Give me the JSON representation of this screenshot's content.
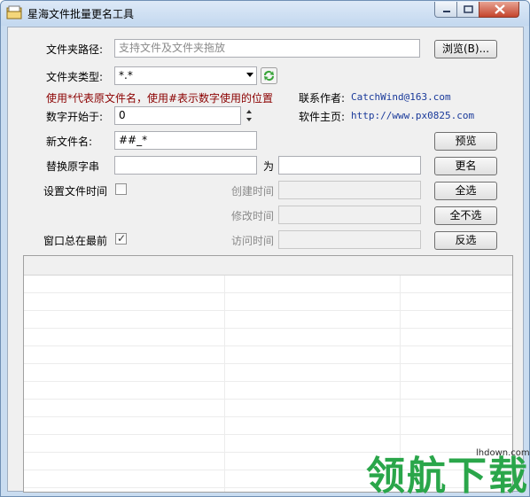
{
  "window": {
    "title": "星海文件批量更名工具",
    "controls": {
      "minimize": "minimize-icon",
      "maximize": "maximize-icon",
      "close": "close-icon"
    }
  },
  "folder_path": {
    "label": "文件夹路径:",
    "placeholder": "支持文件及文件夹拖放",
    "browse_label": "浏览(B)..."
  },
  "folder_type": {
    "label": "文件夹类型:",
    "value": "*.*",
    "refresh_icon": "refresh-icon"
  },
  "hint": "使用*代表原文件名，使用#表示数字使用的位置",
  "contact": {
    "label": "联系作者:",
    "value": "CatchWind@163.com"
  },
  "homepage": {
    "label": "软件主页:",
    "value": "http://www.px0825.com"
  },
  "start_number": {
    "label": "数字开始于:",
    "value": "0"
  },
  "new_name": {
    "label": "新文件名:",
    "value": "##_*"
  },
  "replace": {
    "label": "替换原字串",
    "for_label": "为",
    "find_value": "",
    "replace_value": ""
  },
  "set_time": {
    "label": "设置文件时间",
    "checked": false
  },
  "time_fields": {
    "created": "创建时间",
    "modified": "修改时间",
    "accessed": "访问时间"
  },
  "always_on_top": {
    "label": "窗口总在最前",
    "checked": true
  },
  "buttons": {
    "preview": "预览",
    "rename": "更名",
    "select_all": "全选",
    "select_none": "全不选",
    "invert": "反选"
  },
  "watermark": {
    "text": "领航下载",
    "url": "lhdown.com"
  },
  "colors": {
    "title_bg": "#c9dcf0",
    "hint_text": "#8b0000",
    "link_text": "#1a3a9a",
    "watermark": "#2aa64a"
  }
}
